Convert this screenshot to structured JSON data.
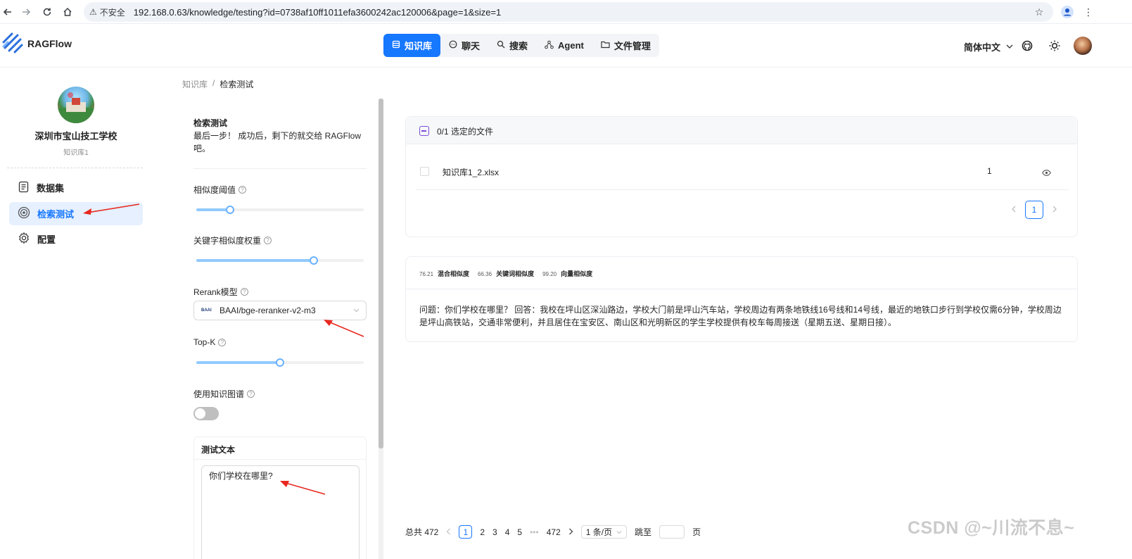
{
  "browser": {
    "insecure_label": "不安全",
    "url": "192.168.0.63/knowledge/testing?id=0738af10ff1011efa3600242ac120006&page=1&size=1",
    "icons": [
      "back-icon",
      "forward-icon",
      "reload-icon",
      "home-icon",
      "star-icon",
      "profile-icon",
      "menu-icon"
    ]
  },
  "header": {
    "brand": "RAGFlow",
    "nav": [
      {
        "label": "知识库",
        "icon": "database-icon",
        "active": true
      },
      {
        "label": "聊天",
        "icon": "chat-icon"
      },
      {
        "label": "搜索",
        "icon": "search-icon"
      },
      {
        "label": "Agent",
        "icon": "agent-icon"
      },
      {
        "label": "文件管理",
        "icon": "folder-icon"
      }
    ],
    "language": "简体中文",
    "accent": "#1677ff"
  },
  "sidebar": {
    "kb_name": "深圳市宝山技工学校",
    "kb_sub": "知识库1",
    "items": [
      {
        "label": "数据集",
        "icon": "dataset-icon"
      },
      {
        "label": "检索测试",
        "icon": "target-icon",
        "active": true
      },
      {
        "label": "配置",
        "icon": "gear-icon"
      }
    ]
  },
  "breadcrumb": {
    "root": "知识库",
    "sep": "/",
    "current": "检索测试"
  },
  "panel": {
    "title": "检索测试",
    "desc": "最后一步！ 成功后，剩下的就交给 RAGFlow 吧。",
    "similarity_label": "相似度阈值",
    "similarity_value": 0.2,
    "keyword_weight_label": "关键字相似度权重",
    "keyword_weight_value": 0.7,
    "rerank_label": "Rerank模型",
    "rerank_value": "BAAI/bge-reranker-v2-m3",
    "rerank_logo": "BAAI",
    "topk_label": "Top-K",
    "topk_value": 0.5,
    "kg_label": "使用知识图谱",
    "kg_enabled": false,
    "test_text_title": "测试文本",
    "test_text_value": "你们学校在哪里?"
  },
  "files": {
    "selected": "0/1  选定的文件",
    "rows": [
      {
        "name": "知识库1_2.xlsx",
        "count": "1"
      }
    ],
    "page": "1"
  },
  "result": {
    "hybrid_score": "76.21",
    "hybrid_label": "混合相似度",
    "keyword_score": "66.36",
    "keyword_label": "关键词相似度",
    "vector_score": "99.20",
    "vector_label": "向量相似度",
    "text": "问题：你们学校在哪里？ 回答：我校在坪山区深汕路边，学校大门前是坪山汽车站，学校周边有两条地铁线16号线和14号线，最近的地铁口步行到学校仅需6分钟，学校周边是坪山高铁站，交通非常便利，并且居住在宝安区、南山区和光明新区的学生学校提供有校车每周接送（星期五送、星期日接）。"
  },
  "pager": {
    "total": "总共 472",
    "pages": [
      "1",
      "2",
      "3",
      "4",
      "5"
    ],
    "ellipsis": "•••",
    "last": "472",
    "size": "1 条/页",
    "jump_label": "跳至",
    "page_unit": "页"
  },
  "watermark": "CSDN @~川流不息~"
}
